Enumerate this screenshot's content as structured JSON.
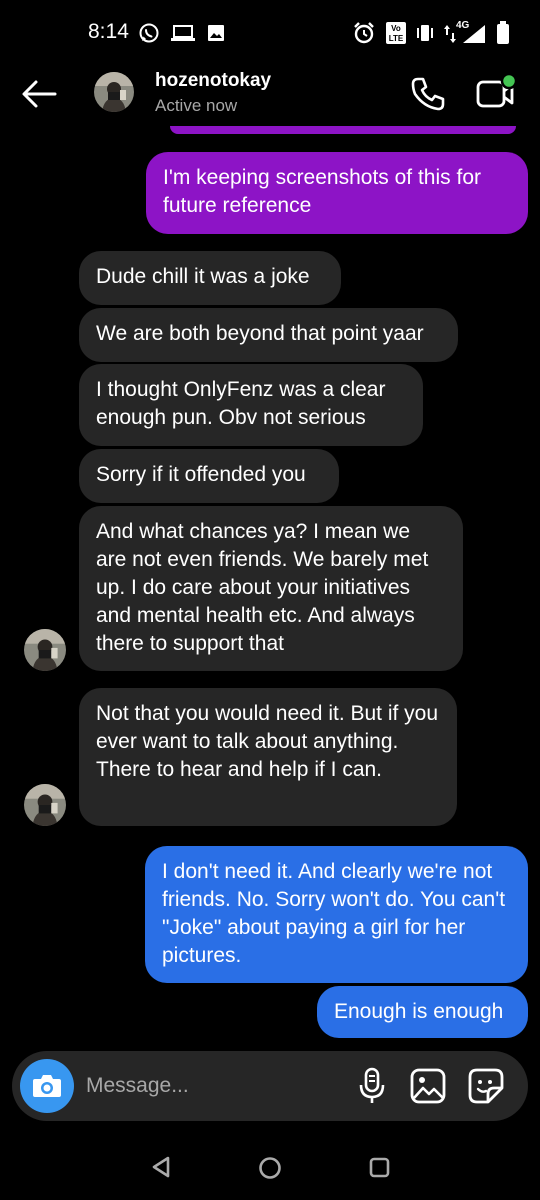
{
  "status_bar": {
    "time": "8:14",
    "network_label": "4G",
    "left_icons": [
      "whatsapp-icon",
      "laptop-icon",
      "image-icon"
    ],
    "right_icons": [
      "alarm-icon",
      "volte-icon",
      "vibrate-icon",
      "data-arrows-icon",
      "signal-icon",
      "battery-icon"
    ]
  },
  "header": {
    "username": "hozenotokay",
    "status": "Active now",
    "icons": [
      "back-arrow-icon",
      "phone-icon",
      "video-call-icon"
    ],
    "online_dot_color": "#44c553"
  },
  "messages": [
    {
      "side": "out",
      "color": "#8d14c6",
      "text": "I'm keeping screenshots of this for future reference"
    },
    {
      "side": "in",
      "text": "Dude chill it was a joke"
    },
    {
      "side": "in",
      "text": "We are both beyond that point yaar"
    },
    {
      "side": "in",
      "text": "I thought OnlyFenz was a clear enough pun. Obv not serious"
    },
    {
      "side": "in",
      "text": "Sorry if it offended you"
    },
    {
      "side": "in",
      "text": "And what chances ya? I mean we are not even friends. We barely met up. I do care about your initiatives and mental health etc. And always there to support that"
    },
    {
      "side": "in",
      "text": "Not that you would need it. But if you ever want to talk about anything. There to hear and help if I can."
    },
    {
      "side": "out",
      "color": "#2a6fe6",
      "text": "I don't need it. And clearly we're not friends. No. Sorry won't do. You can't \"Joke\" about paying a girl for her pictures."
    },
    {
      "side": "out",
      "color": "#2a6fe6",
      "text": "Enough is enough"
    }
  ],
  "composer": {
    "placeholder": "Message...",
    "icons": [
      "camera-icon",
      "microphone-icon",
      "gallery-icon",
      "sticker-icon"
    ],
    "camera_color": "#3897f0"
  },
  "nav_bar": {
    "icons": [
      "nav-back-icon",
      "nav-home-icon",
      "nav-recents-icon"
    ]
  }
}
